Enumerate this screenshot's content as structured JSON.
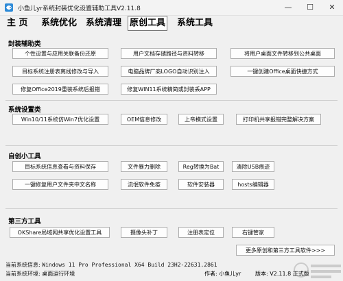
{
  "window": {
    "title": "小鱼儿yr系统封装优化设置辅助工具V2.11.8",
    "minimize_glyph": "—",
    "maximize_glyph": "☐",
    "close_glyph": "✕"
  },
  "tabs": [
    {
      "label": "主 页"
    },
    {
      "label": "系统优化"
    },
    {
      "label": "系统清理"
    },
    {
      "label": "原创工具"
    },
    {
      "label": "系统工具"
    }
  ],
  "groups": {
    "packaging": {
      "title": "封装辅助类",
      "buttons": [
        "个性设置与应用关联备份还原",
        "用户文档存储路径与资料转移",
        "将用户桌面文件转移到公共桌面",
        "目标系统注册表离线修改与导入",
        "电脑品牌厂商LOGO自动识别注入",
        "一键创建Office桌面快捷方式",
        "修复Office2019重装系统后报错",
        "修复WIN11系统精简或封装丢APP"
      ]
    },
    "settings": {
      "title": "系统设置类",
      "buttons": [
        "Win10/11系统仿Win7优化设置",
        "OEM信息修改",
        "上帝模式设置",
        "打印机共享报错完整解决方案"
      ]
    },
    "original": {
      "title": "自创小工具",
      "buttons": [
        "目标系统信息查看与资料保存",
        "文件暴力删除",
        "Reg转换为Bat",
        "清除USB痕迹",
        "一键修复用户文件夹中文名称",
        "流氓软件免疫",
        "软件安装器",
        "hosts编辑器"
      ]
    },
    "third_party": {
      "title": "第三方工具",
      "buttons": [
        "OKShare局域网共享优化设置工具",
        "摄像头补丁",
        "注册表定位",
        "右键管家"
      ],
      "more_label": "更多原创和第三方工具软件>>>"
    }
  },
  "status": {
    "system_info_label": "当前系统信息:",
    "system_info_value": "Windows 11 Pro Professional X64 Build 23H2-22631.2861",
    "environment_label": "当前系统环境:",
    "environment_value": "桌面运行环境",
    "author_label": "作者:",
    "author_value": "小鱼儿yr",
    "version_label": "版本:",
    "version_value": "V2.11.8",
    "edition": "正式版"
  },
  "colors": {
    "background": "#f0f0f0",
    "border": "#adadad"
  }
}
